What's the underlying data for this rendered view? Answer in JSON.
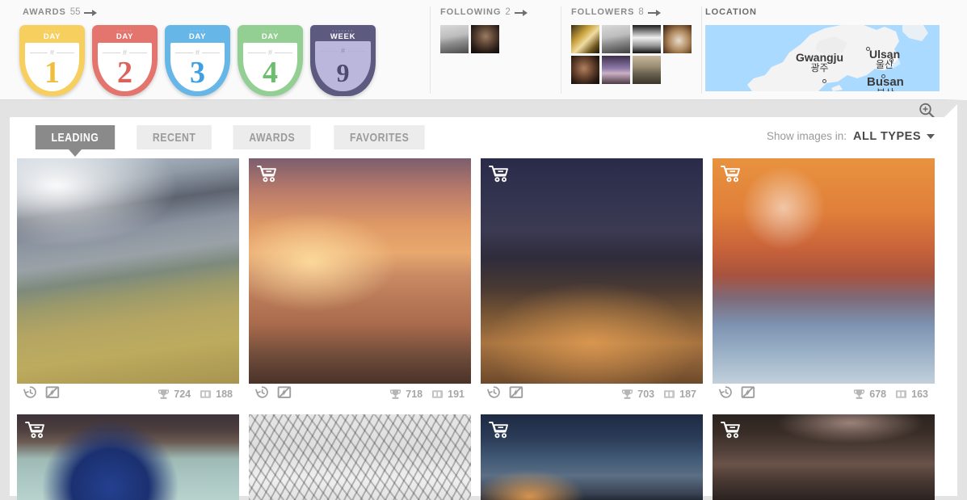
{
  "header": {
    "awards": {
      "label": "AWARDS",
      "count": "55",
      "arrow_icon": "arrow-right-icon"
    },
    "following": {
      "label": "FOLLOWING",
      "count": "2",
      "arrow_icon": "arrow-right-icon"
    },
    "followers": {
      "label": "FOLLOWERS",
      "count": "8",
      "arrow_icon": "arrow-right-icon"
    },
    "location": {
      "label": "LOCATION"
    }
  },
  "badges": [
    {
      "top_label": "DAY",
      "number": "1",
      "color": "#f6cf5f",
      "num_color": "#efbe3d",
      "dots": "·····"
    },
    {
      "top_label": "DAY",
      "number": "2",
      "color": "#e4756e",
      "num_color": "#dd6059",
      "dots": "·····"
    },
    {
      "top_label": "DAY",
      "number": "3",
      "color": "#66b7e8",
      "num_color": "#3f9fe0",
      "dots": "·····"
    },
    {
      "top_label": "DAY",
      "number": "4",
      "color": "#93ce93",
      "num_color": "#6cbd6c",
      "dots": "·····"
    },
    {
      "top_label": "WEEK",
      "number": "9",
      "color": "#5d5a80",
      "num_color": "#4d4a70",
      "dots": "·······"
    }
  ],
  "map": {
    "water_color": "#aadaff",
    "land_color": "#f3f3f3",
    "cities": [
      {
        "en": "Gwangju",
        "kr": "광주"
      },
      {
        "en": "Ulsan",
        "kr": "울산"
      },
      {
        "en": "Busan",
        "kr": "부산"
      }
    ]
  },
  "toolbar": {
    "zoom_icon": "zoom-in-icon",
    "tabs": [
      {
        "label": "LEADING",
        "active": true
      },
      {
        "label": "RECENT",
        "active": false
      },
      {
        "label": "AWARDS",
        "active": false
      },
      {
        "label": "FAVORITES",
        "active": false
      }
    ],
    "filter_label": "Show images in:",
    "filter_value": "ALL TYPES",
    "filter_caret_icon": "chevron-down-icon"
  },
  "gallery": {
    "icons": {
      "history": "history-clock-icon",
      "flash_off": "flash-off-icon",
      "award": "trophy-icon",
      "views": "views-icon",
      "cart": "shopping-cart-icon"
    },
    "row1": [
      {
        "alt": "terraced-rice-fields-sunbeams",
        "cart": false,
        "awards": "724",
        "views": "188"
      },
      {
        "alt": "mosque-at-sunset-over-water",
        "cart": true,
        "awards": "718",
        "views": "191"
      },
      {
        "alt": "night-city-highway-interchange",
        "cart": true,
        "awards": "703",
        "views": "187"
      },
      {
        "alt": "water-droplet-macro-reflection",
        "cart": true,
        "awards": "678",
        "views": "163"
      }
    ],
    "row2": [
      {
        "alt": "blue-sphere-under-rock-macro",
        "cart": true
      },
      {
        "alt": "snow-covered-branches-bw",
        "cart": false
      },
      {
        "alt": "suspension-bridge-at-dusk",
        "cart": true
      },
      {
        "alt": "night-skyline-with-clouds",
        "cart": true
      }
    ]
  }
}
